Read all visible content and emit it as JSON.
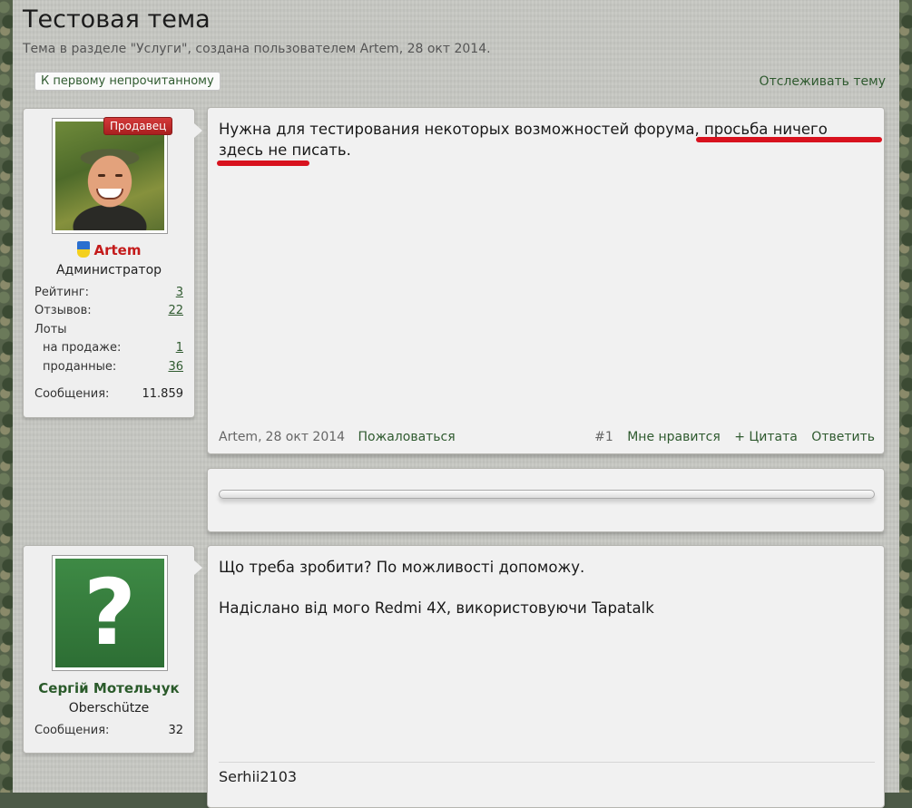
{
  "thread": {
    "title": "Тестовая тема",
    "subtitle": "Тема в разделе \"Услуги\", создана пользователем Artem, 28 окт 2014.",
    "unread_button": "К первому непрочитанному",
    "watch_link": "Отслеживать тему"
  },
  "posts": [
    {
      "user": {
        "name": "Artem",
        "badge": "Продавец",
        "title": "Администратор",
        "name_color": "#c41b1b",
        "stats": {
          "rating_label": "Рейтинг:",
          "rating_value": "3",
          "reviews_label": "Отзывов:",
          "reviews_value": "22",
          "lots_label": "Лоты",
          "on_sale_label": "на продаже:",
          "on_sale_value": "1",
          "sold_label": "проданные:",
          "sold_value": "36",
          "messages_label": "Сообщения:",
          "messages_value": "11.859"
        }
      },
      "text_part1": "Нужна для тестирования некоторых возможностей форума, просьба ничего здесь не писать.",
      "footer": {
        "author": "Artem",
        "date": "28 окт 2014",
        "report": "Пожаловаться",
        "post_number": "#1",
        "like": "Мне нравится",
        "quote": "+ Цитата",
        "reply": "Ответить"
      }
    },
    {
      "user": {
        "name": "Сергій Мотельчук",
        "title": "Oberschütze",
        "name_color": "#2a5a2a",
        "avatar_glyph": "?",
        "stats": {
          "messages_label": "Сообщения:",
          "messages_value": "32"
        }
      },
      "text_line1": "Що треба зробити? По можливості допоможу.",
      "text_line2": "Надіслано від мого Redmi 4X, використовуючи Tapatalk",
      "signature": "Serhii2103"
    }
  ],
  "colors": {
    "link": "#2f5a2f",
    "highlight_underline": "#d8121e",
    "seller_badge": "#c42a2a"
  }
}
